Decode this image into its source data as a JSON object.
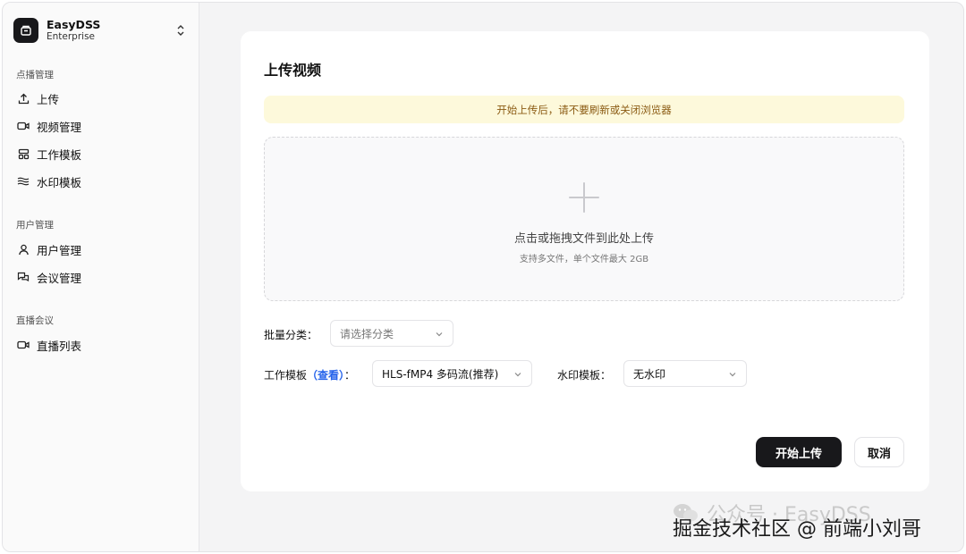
{
  "sidebar": {
    "brand": {
      "name": "EasyDSS",
      "edition": "Enterprise",
      "logo_icon": "box-icon",
      "switch_icon": "chevron-up-down-icon"
    },
    "groups": [
      {
        "label": "点播管理",
        "items": [
          {
            "label": "上传",
            "icon": "upload-icon"
          },
          {
            "label": "视频管理",
            "icon": "video-camera-icon"
          },
          {
            "label": "工作模板",
            "icon": "layout-template-icon"
          },
          {
            "label": "水印模板",
            "icon": "waves-icon"
          }
        ]
      },
      {
        "label": "用户管理",
        "items": [
          {
            "label": "用户管理",
            "icon": "user-icon"
          },
          {
            "label": "会议管理",
            "icon": "chat-bubbles-icon"
          }
        ]
      },
      {
        "label": "直播会议",
        "items": [
          {
            "label": "直播列表",
            "icon": "video-camera-icon"
          }
        ]
      }
    ]
  },
  "main": {
    "title": "上传视频",
    "notice": "开始上传后，请不要刷新或关闭浏览器",
    "dropzone": {
      "primary": "点击或拖拽文件到此处上传",
      "secondary": "支持多文件，单个文件最大 2GB",
      "icon": "plus-icon"
    },
    "form": {
      "category_label": "批量分类：",
      "category_placeholder": "请选择分类",
      "template_label": "工作模板",
      "template_link": "（查看）",
      "template_colon": "：",
      "template_value": "HLS-fMP4 多码流(推荐)",
      "watermark_label": "水印模板：",
      "watermark_value": "无水印"
    },
    "actions": {
      "start": "开始上传",
      "cancel": "取消"
    },
    "colors": {
      "notice_bg": "#fdf9db",
      "notice_text": "#8a5a12",
      "link": "#2563eb",
      "primary": "#18181b"
    }
  },
  "watermark": {
    "faded": "公众号 · EasyDSS",
    "main": "掘金技术社区 @ 前端小刘哥"
  }
}
